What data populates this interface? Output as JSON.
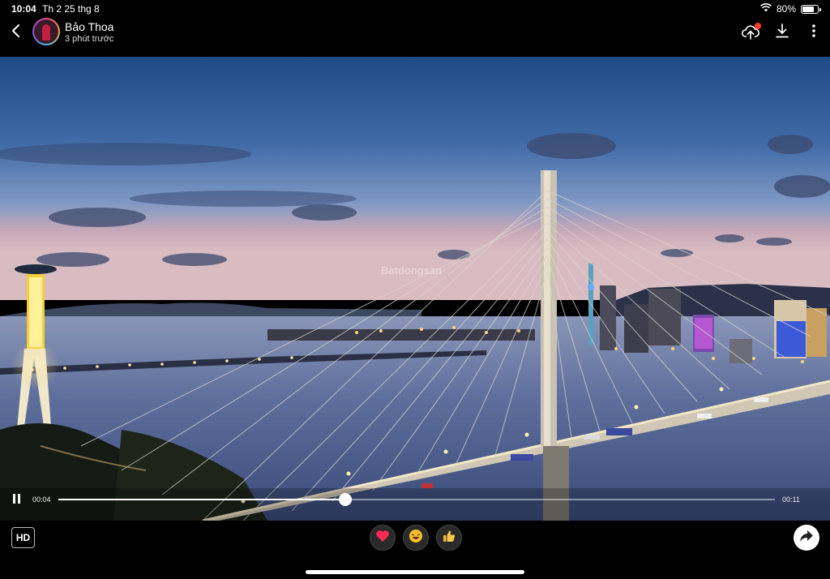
{
  "status_bar": {
    "time": "10:04",
    "date": "Th 2 25 thg 8",
    "battery_text": "80%",
    "battery_level": 0.8,
    "icons": [
      "wifi-icon",
      "battery-icon"
    ]
  },
  "header": {
    "user_name": "Bảo Thoa",
    "posted_time": "3 phút trước",
    "icons": [
      "back-icon",
      "upload-icon",
      "download-icon",
      "more-icon"
    ],
    "notification_color": "#ff3b30"
  },
  "video": {
    "watermark": "Batdongsan",
    "current_time": "00:04",
    "total_time": "00:11",
    "progress": 0.4,
    "state": "playing"
  },
  "bottom_bar": {
    "quality_label": "HD",
    "reactions": [
      {
        "name": "heart-icon",
        "glyph": "❤"
      },
      {
        "name": "haha-icon",
        "glyph": "😆"
      },
      {
        "name": "like-icon",
        "glyph": "👍"
      }
    ],
    "share_icon": "share-icon"
  }
}
